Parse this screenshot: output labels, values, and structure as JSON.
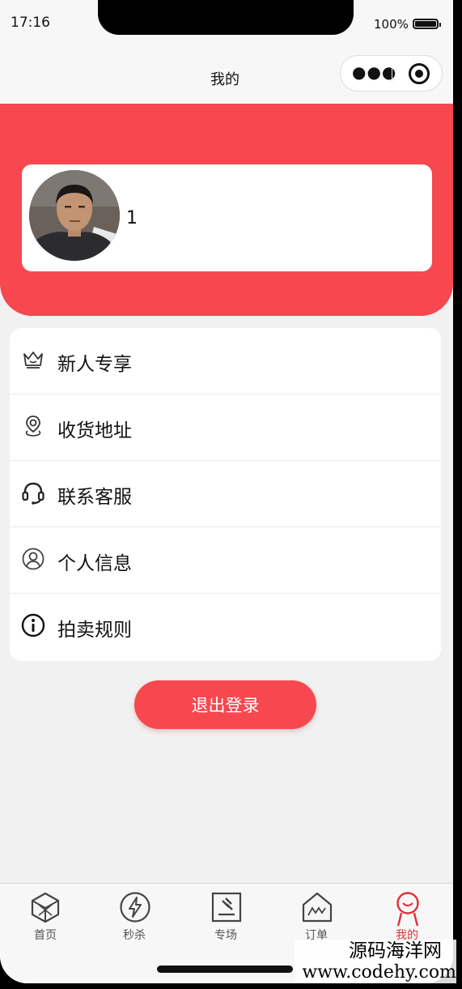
{
  "status_bar": {
    "time": "17:16",
    "battery_percent": "100%"
  },
  "navbar": {
    "title": "我的",
    "more_icon": "more-dots-icon",
    "close_icon": "target-circle-icon"
  },
  "profile": {
    "name": "1"
  },
  "menu": {
    "items": [
      {
        "label": "新人专享",
        "icon": "crown-icon"
      },
      {
        "label": "收货地址",
        "icon": "location-pin-icon"
      },
      {
        "label": "联系客服",
        "icon": "headset-icon"
      },
      {
        "label": "个人信息",
        "icon": "user-circle-icon"
      },
      {
        "label": "拍卖规则",
        "icon": "info-icon"
      }
    ]
  },
  "logout_label": "退出登录",
  "tabbar": {
    "tabs": [
      {
        "label": "首页",
        "icon": "cube-icon"
      },
      {
        "label": "秒杀",
        "icon": "lightning-icon"
      },
      {
        "label": "专场",
        "icon": "auction-hammer-icon"
      },
      {
        "label": "订单",
        "icon": "house-icon"
      },
      {
        "label": "我的",
        "icon": "user-icon",
        "active": true
      }
    ]
  },
  "watermark": {
    "line1": "源码海洋网",
    "line2": "www.codehy.com"
  },
  "colors": {
    "accent": "#f7474f",
    "background": "#f1f1f1",
    "active_tab": "#e0303a"
  }
}
